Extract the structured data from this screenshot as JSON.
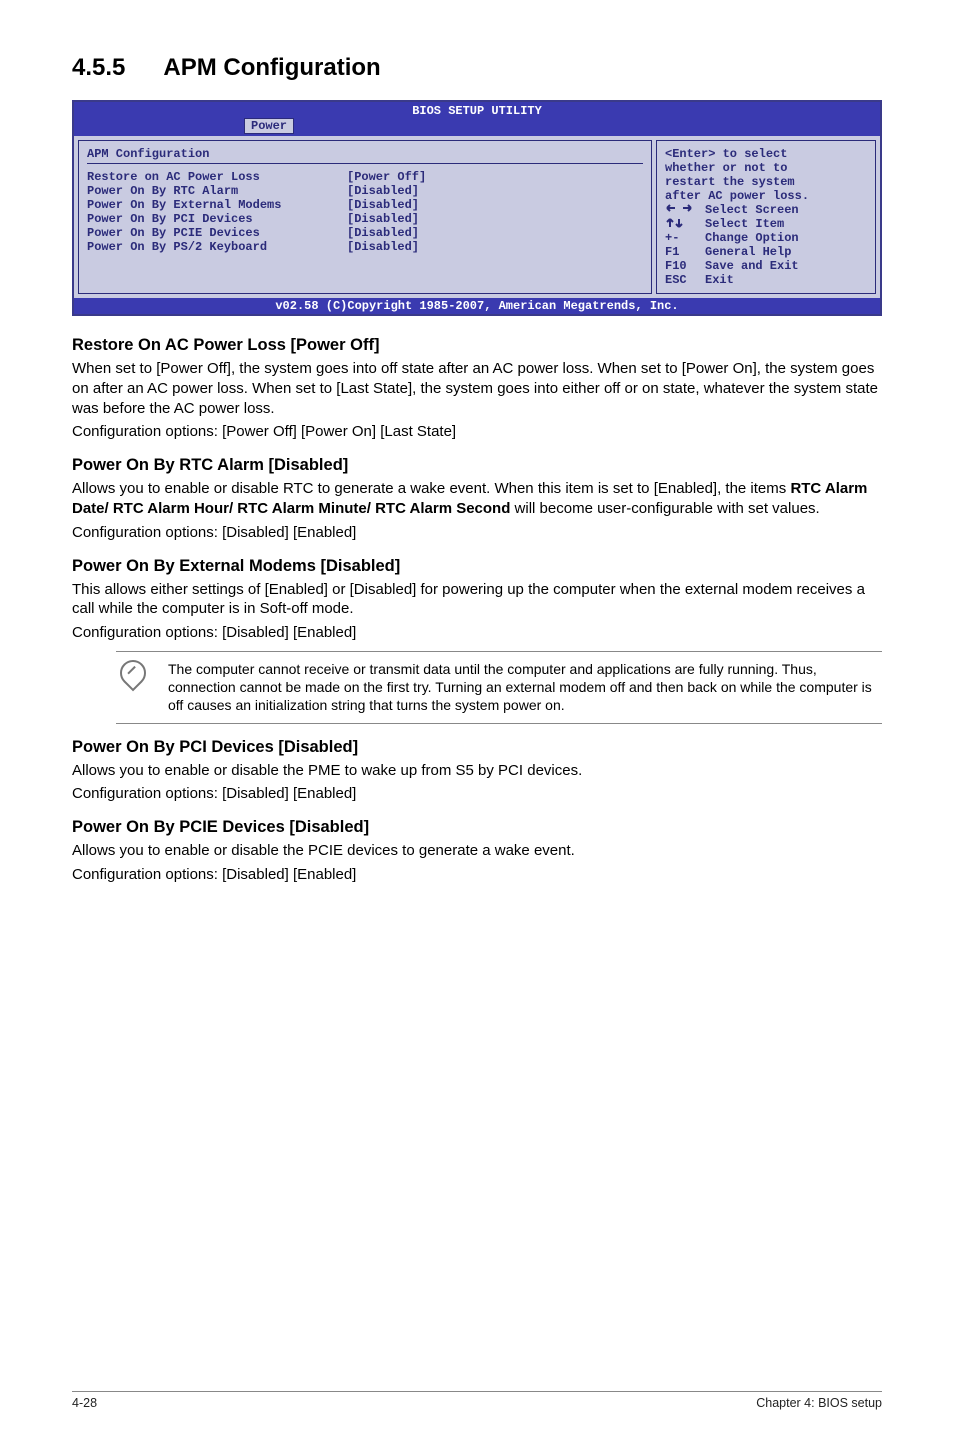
{
  "section": {
    "number": "4.5.5",
    "title": "APM Configuration"
  },
  "bios": {
    "title": "BIOS SETUP UTILITY",
    "tab": "Power",
    "panel_heading": "APM Configuration",
    "rows": [
      {
        "label": "Restore on AC Power Loss",
        "value": "[Power Off]"
      },
      {
        "label": "Power On By RTC Alarm",
        "value": "[Disabled]"
      },
      {
        "label": "Power On By External Modems",
        "value": "[Disabled]"
      },
      {
        "label": "Power On By PCI Devices",
        "value": "[Disabled]"
      },
      {
        "label": "Power On By PCIE Devices",
        "value": "[Disabled]"
      },
      {
        "label": "Power On By PS/2 Keyboard",
        "value": "[Disabled]"
      }
    ],
    "help": {
      "l1": "<Enter> to select",
      "l2": "whether or not to",
      "l3": "restart the system",
      "l4": "after AC power loss."
    },
    "keys": {
      "l1": "Select Screen",
      "l2": "Select Item",
      "l3": "Change Option",
      "l4": "General Help",
      "l5": "Save and Exit",
      "l6": "Exit",
      "k1": "←→",
      "k2": "↑↓",
      "k3": "+-",
      "k4": "F1",
      "k5": "F10",
      "k6": "ESC"
    },
    "footer": "v02.58 (C)Copyright 1985-2007, American Megatrends, Inc."
  },
  "sections": [
    {
      "heading": "Restore On AC Power Loss [Power Off]",
      "body": "When set to [Power Off], the system goes into off state after an AC power loss. When set to [Power On], the system goes on after an AC power loss. When set to [Last State], the system goes into either off or on state, whatever the system state was before the AC power loss.",
      "opts": "Configuration options: [Power Off] [Power On] [Last State]"
    },
    {
      "heading": "Power On By RTC Alarm [Disabled]",
      "body_pre": "Allows you to enable or disable RTC to generate a wake event. When this item is set to [Enabled], the items ",
      "body_bold": "RTC Alarm Date/ RTC Alarm Hour/ RTC Alarm Minute/ RTC Alarm Second",
      "body_post": " will become user-configurable with set values.",
      "opts": "Configuration options: [Disabled] [Enabled]"
    },
    {
      "heading": "Power On By External Modems [Disabled]",
      "body": "This allows either settings of [Enabled] or [Disabled] for powering up the computer when the external modem receives a call while the computer is in Soft-off mode.",
      "opts": "Configuration options: [Disabled] [Enabled]"
    }
  ],
  "note": "The computer cannot receive or transmit data until the computer and applications are fully running. Thus, connection cannot be made on the first try. Turning an external modem off and then back on while the computer is off causes an initialization string that turns the system power on.",
  "sections2": [
    {
      "heading": "Power On By PCI Devices [Disabled]",
      "body": "Allows you to enable or disable the PME to wake up from S5 by PCI devices.",
      "opts": "Configuration options: [Disabled] [Enabled]"
    },
    {
      "heading": "Power On By PCIE Devices [Disabled]",
      "body": "Allows you to enable or disable the PCIE devices to generate a wake event.",
      "opts": "Configuration options: [Disabled] [Enabled]"
    }
  ],
  "footer": {
    "left": "4-28",
    "right": "Chapter 4: BIOS setup"
  }
}
